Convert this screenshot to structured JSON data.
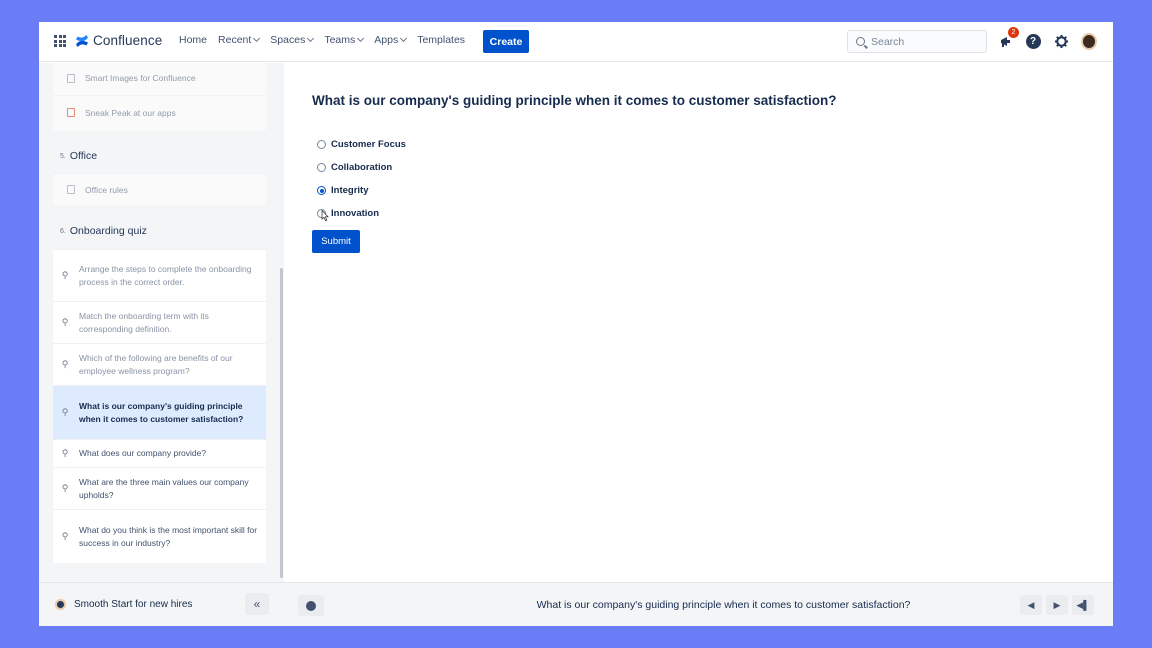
{
  "app": {
    "name": "Confluence"
  },
  "nav": {
    "links": [
      {
        "label": "Home",
        "dropdown": false
      },
      {
        "label": "Recent",
        "dropdown": true
      },
      {
        "label": "Spaces",
        "dropdown": true
      },
      {
        "label": "Teams",
        "dropdown": true
      },
      {
        "label": "Apps",
        "dropdown": true
      },
      {
        "label": "Templates",
        "dropdown": false
      }
    ],
    "create_label": "Create",
    "search_placeholder": "Search",
    "notification_count": "2"
  },
  "sidebar": {
    "top_items": [
      {
        "label": "Smart Images for Confluence"
      },
      {
        "label": "Sneak Peak at our apps"
      }
    ],
    "sections": [
      {
        "number": "5.",
        "title": "Office",
        "items": [
          "Office rules"
        ]
      },
      {
        "number": "6.",
        "title": "Onboarding quiz"
      }
    ],
    "quiz_items": [
      "Arrange the steps to complete the onboarding process in the correct order.",
      "Match the onboarding term with its corresponding definition.",
      "Which of the following are benefits of our employee wellness program?",
      "What is our company's guiding principle when it comes to customer satisfaction?",
      "What does our company provide?",
      "What are the three main values our company upholds?",
      "What do you think is the most important skill for success in our industry?"
    ],
    "active_quiz_index": 3
  },
  "question": {
    "title": "What is our company's guiding principle when it comes to customer satisfaction?",
    "options": [
      "Customer Focus",
      "Collaboration",
      "Integrity",
      "Innovation"
    ],
    "selected_index": 2,
    "submit_label": "Submit"
  },
  "footer": {
    "space_name": "Smooth Start for new hires",
    "collapse_glyph": "«",
    "page_title": "What is our company's guiding principle when it comes to customer satisfaction?"
  },
  "colors": {
    "accent": "#0052cc",
    "background": "#6b7cf7",
    "active_item": "#deebff"
  }
}
